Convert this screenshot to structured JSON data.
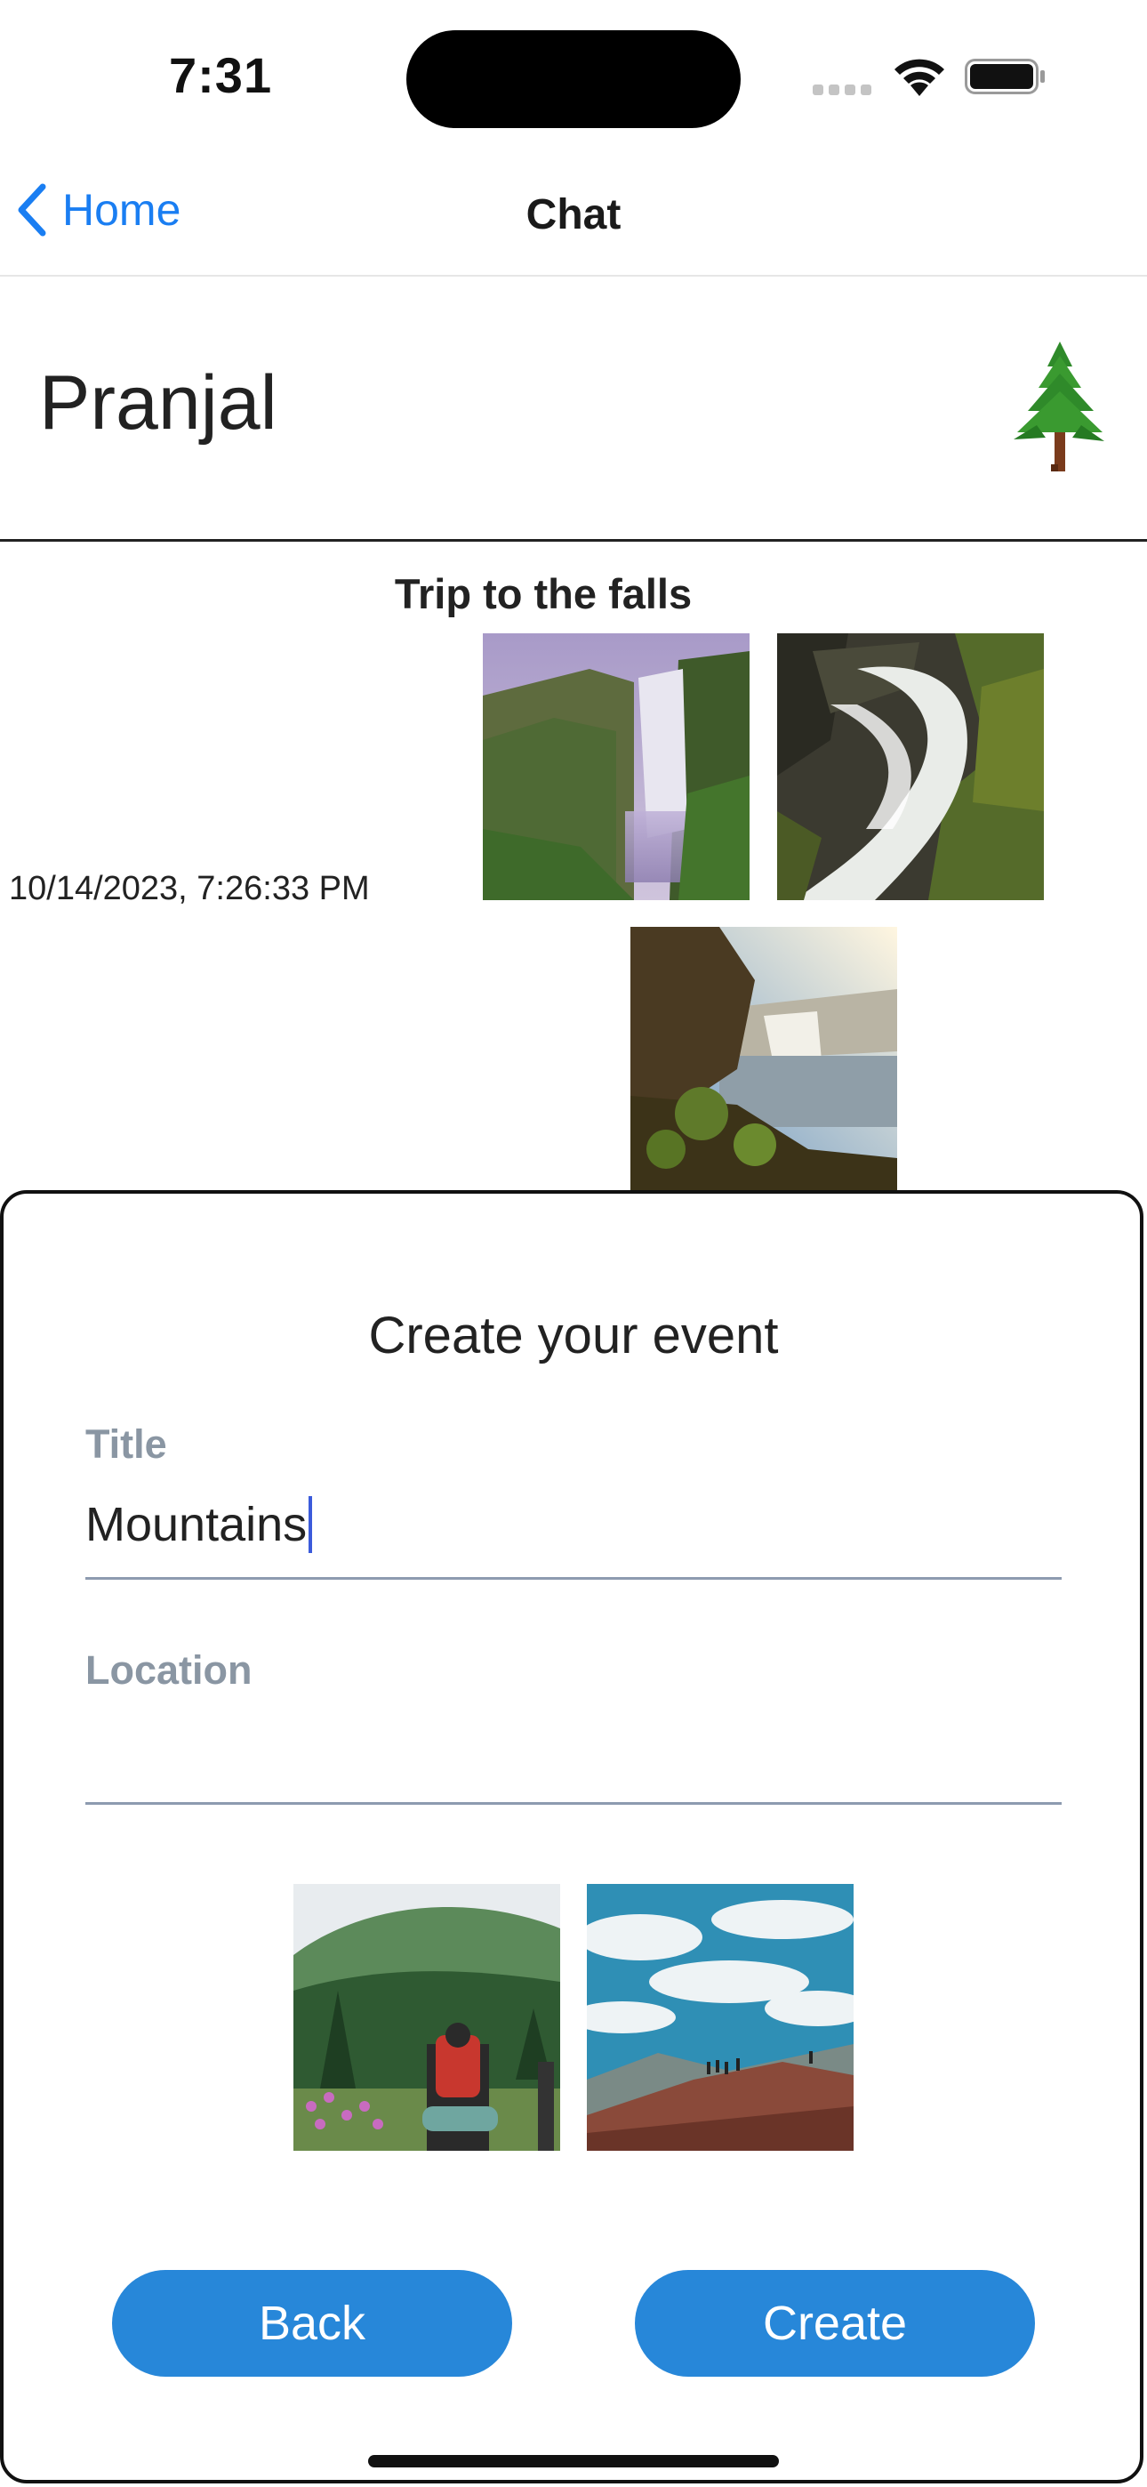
{
  "status_bar": {
    "time": "7:31"
  },
  "nav": {
    "back_label": "Home",
    "title": "Chat"
  },
  "header": {
    "username": "Pranjal",
    "avatar_icon": "pine-tree-icon"
  },
  "post": {
    "title": "Trip to the falls",
    "timestamp": "10/14/2023, 7:26:33 PM",
    "photos": [
      "waterfall-photo-1",
      "waterfall-photo-2",
      "waterfall-photo-3"
    ]
  },
  "modal": {
    "heading": "Create your event",
    "title_label": "Title",
    "title_value": "Mountains",
    "location_label": "Location",
    "location_value": "",
    "photos": [
      "hiker-forest-photo",
      "hikers-ridge-photo"
    ],
    "back_label": "Back",
    "create_label": "Create"
  },
  "colors": {
    "accent": "#2787d9",
    "link": "#1a7ef2",
    "label": "#8a96a3"
  }
}
